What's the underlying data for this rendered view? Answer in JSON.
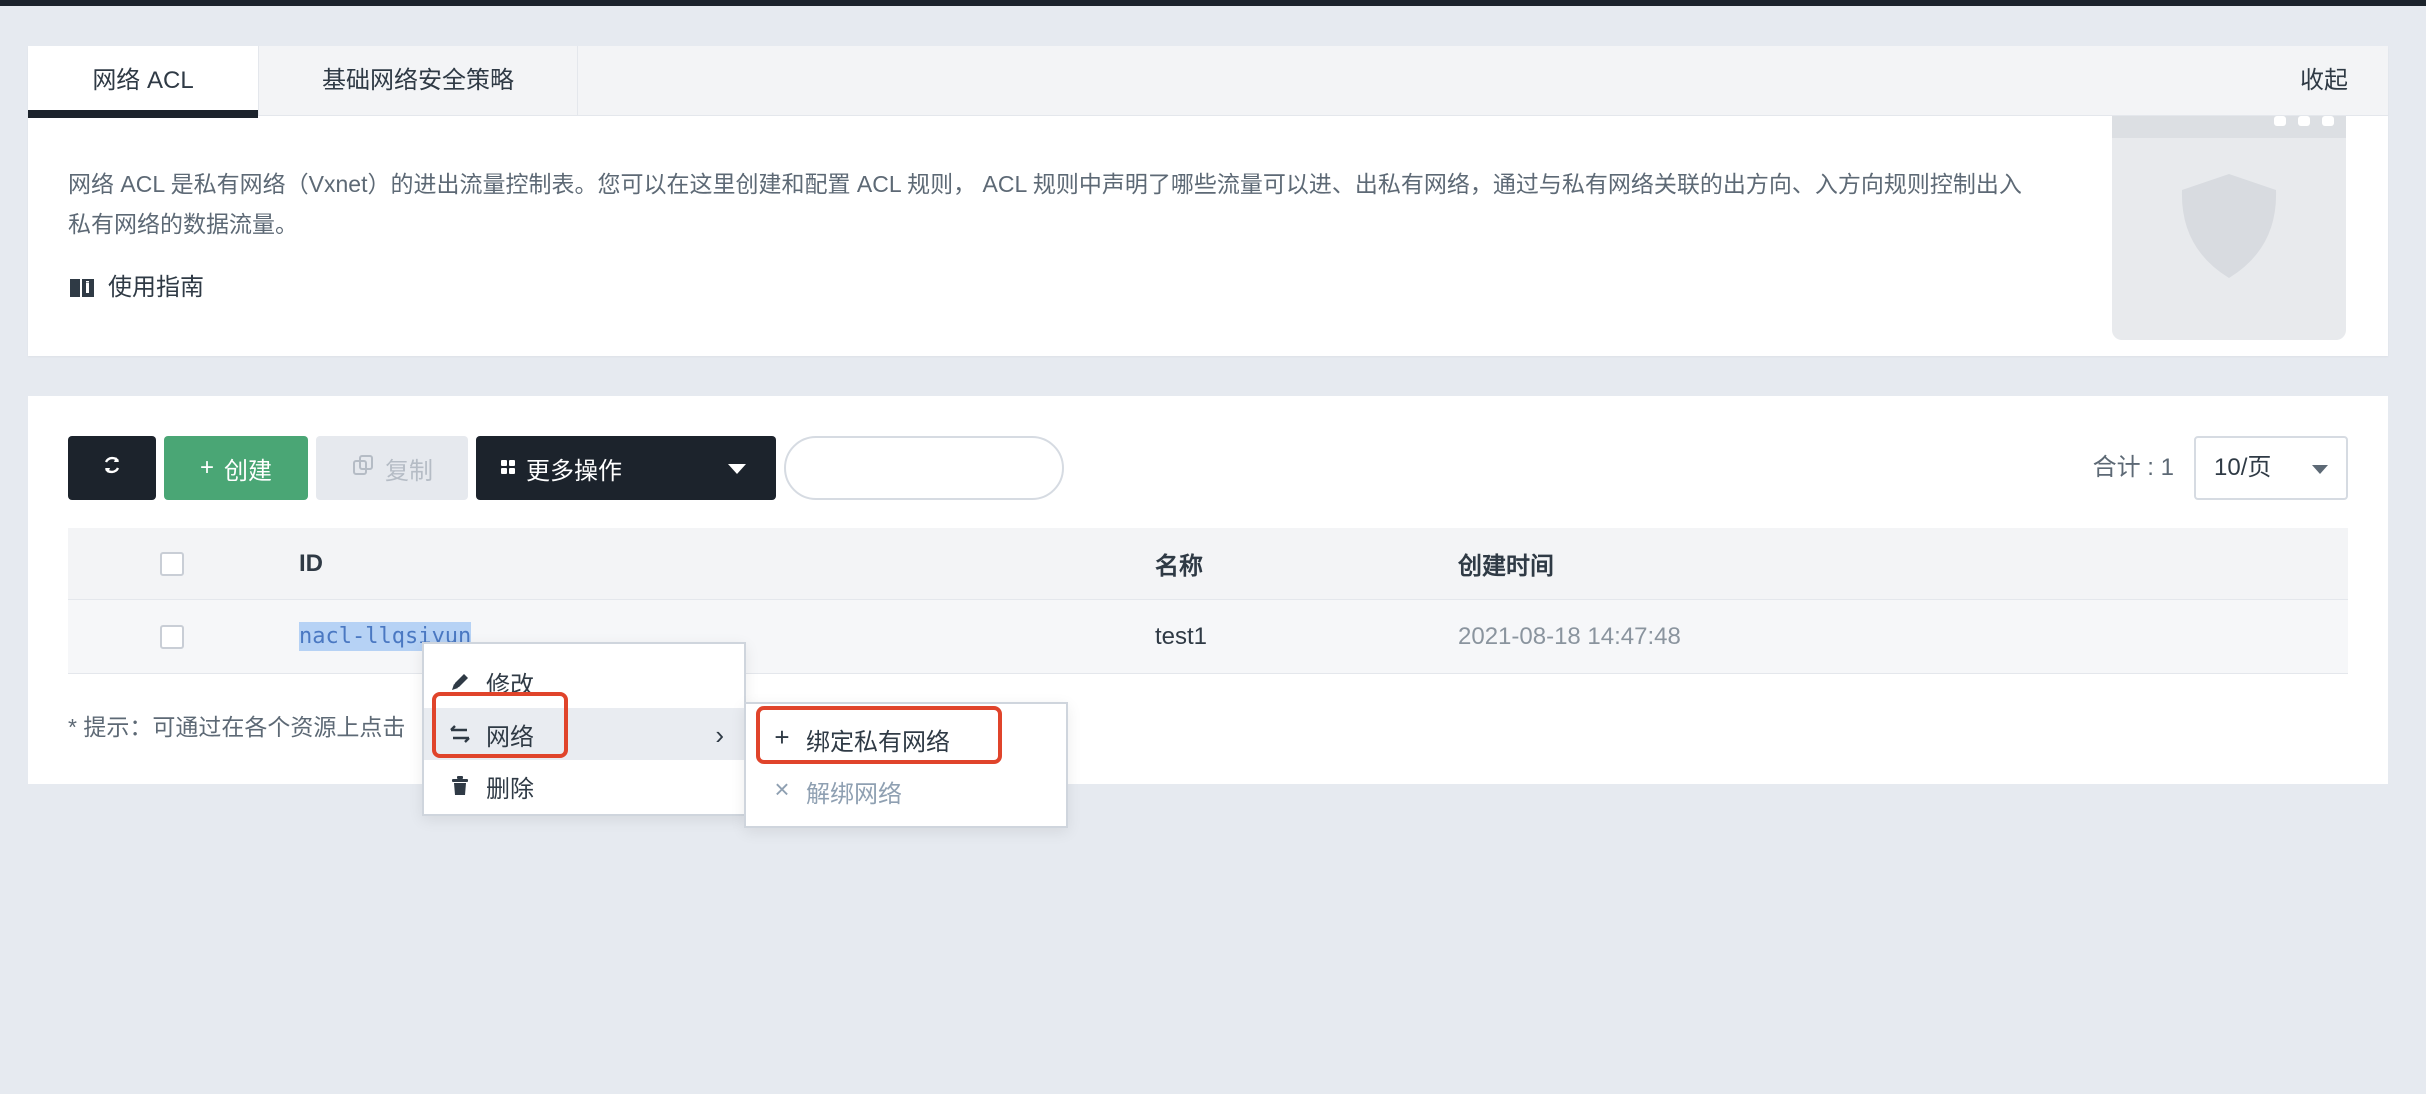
{
  "tabs": [
    {
      "label": "网络 ACL",
      "active": true
    },
    {
      "label": "基础网络安全策略",
      "active": false
    }
  ],
  "collapse_label": "收起",
  "intro": {
    "description": "网络 ACL 是私有网络（Vxnet）的进出流量控制表。您可以在这里创建和配置 ACL 规则， ACL 规则中声明了哪些流量可以进、出私有网络，通过与私有网络关联的出方向、入方向规则控制出入私有网络的数据流量。",
    "guide_label": "使用指南",
    "guide_icon": "book-icon",
    "illustration": "shield-window-illustration"
  },
  "toolbar": {
    "refresh_icon": "refresh-icon",
    "create_label": "创建",
    "create_icon": "plus-icon",
    "copy_label": "复制",
    "copy_icon": "copy-icon",
    "more_label": "更多操作",
    "more_icon": "grid-icon",
    "search_value": "",
    "search_placeholder": ""
  },
  "pagination": {
    "total_text": "合计 : 1",
    "page_size": "10/页"
  },
  "table": {
    "columns": [
      "ID",
      "名称",
      "创建时间"
    ],
    "rows": [
      {
        "id": "nacl-llqsiyun",
        "name": "test1",
        "created": "2021-08-18 14:47:48",
        "selected": false
      }
    ]
  },
  "hint_text": "* 提示：可通过在各个资源上点击",
  "context_menu": {
    "items": [
      {
        "label": "修改",
        "icon": "edit-icon"
      },
      {
        "label": "网络",
        "icon": "swap-icon",
        "has_submenu": true
      },
      {
        "label": "删除",
        "icon": "trash-icon"
      }
    ]
  },
  "submenu": {
    "items": [
      {
        "label": "绑定私有网络",
        "icon": "plus-icon",
        "enabled": true
      },
      {
        "label": "解绑网络",
        "icon": "x-icon",
        "enabled": false
      }
    ]
  },
  "colors": {
    "primary_dark": "#1c232c",
    "create_green": "#4aa675",
    "highlight_red": "#e0442b",
    "page_bg": "#e6eaf0"
  }
}
